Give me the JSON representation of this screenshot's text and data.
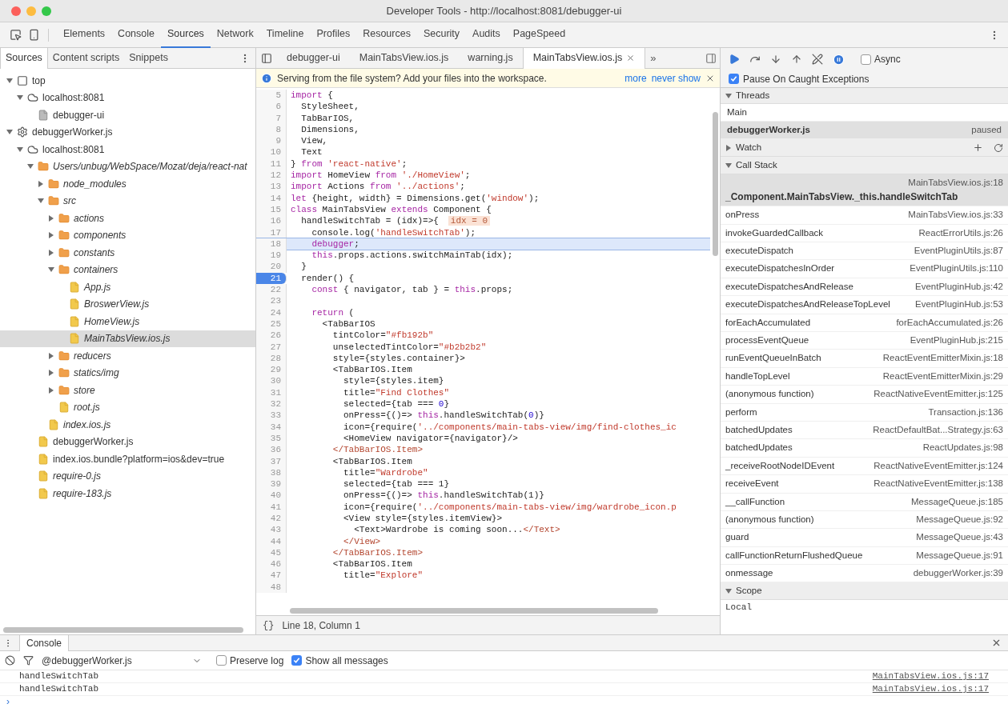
{
  "window": {
    "title": "Developer Tools - http://localhost:8081/debugger-ui"
  },
  "panel_tabs": [
    {
      "label": "Elements",
      "selected": false
    },
    {
      "label": "Console",
      "selected": false
    },
    {
      "label": "Sources",
      "selected": true
    },
    {
      "label": "Network",
      "selected": false
    },
    {
      "label": "Timeline",
      "selected": false
    },
    {
      "label": "Profiles",
      "selected": false
    },
    {
      "label": "Resources",
      "selected": false
    },
    {
      "label": "Security",
      "selected": false
    },
    {
      "label": "Audits",
      "selected": false
    },
    {
      "label": "PageSpeed",
      "selected": false
    }
  ],
  "navigator": {
    "tabs": [
      {
        "label": "Sources",
        "selected": true
      },
      {
        "label": "Content scripts",
        "selected": false
      },
      {
        "label": "Snippets",
        "selected": false
      }
    ],
    "tree": [
      {
        "label": "top",
        "kind": "frame",
        "expanded": true,
        "selected": false,
        "italic": false,
        "children": [
          {
            "label": "localhost:8081",
            "kind": "cloud",
            "expanded": true,
            "selected": false,
            "italic": false,
            "children": [
              {
                "label": "debugger-ui",
                "kind": "page",
                "selected": false,
                "italic": false
              }
            ]
          }
        ]
      },
      {
        "label": "debuggerWorker.js",
        "kind": "gear",
        "expanded": true,
        "selected": false,
        "italic": false,
        "children": [
          {
            "label": "localhost:8081",
            "kind": "cloud",
            "expanded": true,
            "selected": false,
            "italic": false,
            "children": [
              {
                "label": "Users/unbug/WebSpace/Mozat/deja/react-nat",
                "kind": "folder",
                "expanded": true,
                "selected": false,
                "italic": true,
                "children": [
                  {
                    "label": "node_modules",
                    "kind": "folder",
                    "expanded": false,
                    "selected": false,
                    "italic": true
                  },
                  {
                    "label": "src",
                    "kind": "folder",
                    "expanded": true,
                    "selected": false,
                    "italic": true,
                    "children": [
                      {
                        "label": "actions",
                        "kind": "folder",
                        "expanded": false,
                        "selected": false,
                        "italic": true
                      },
                      {
                        "label": "components",
                        "kind": "folder",
                        "expanded": false,
                        "selected": false,
                        "italic": true
                      },
                      {
                        "label": "constants",
                        "kind": "folder",
                        "expanded": false,
                        "selected": false,
                        "italic": true
                      },
                      {
                        "label": "containers",
                        "kind": "folder",
                        "expanded": true,
                        "selected": false,
                        "italic": true,
                        "children": [
                          {
                            "label": "App.js",
                            "kind": "file",
                            "selected": false,
                            "italic": true
                          },
                          {
                            "label": "BroswerView.js",
                            "kind": "file",
                            "selected": false,
                            "italic": true
                          },
                          {
                            "label": "HomeView.js",
                            "kind": "file",
                            "selected": false,
                            "italic": true
                          },
                          {
                            "label": "MainTabsView.ios.js",
                            "kind": "file",
                            "selected": true,
                            "italic": true
                          }
                        ]
                      },
                      {
                        "label": "reducers",
                        "kind": "folder",
                        "expanded": false,
                        "selected": false,
                        "italic": true
                      },
                      {
                        "label": "statics/img",
                        "kind": "folder",
                        "expanded": false,
                        "selected": false,
                        "italic": true
                      },
                      {
                        "label": "store",
                        "kind": "folder",
                        "expanded": false,
                        "selected": false,
                        "italic": true
                      },
                      {
                        "label": "root.js",
                        "kind": "file",
                        "selected": false,
                        "italic": true
                      }
                    ]
                  },
                  {
                    "label": "index.ios.js",
                    "kind": "file",
                    "selected": false,
                    "italic": true
                  }
                ]
              },
              {
                "label": "debuggerWorker.js",
                "kind": "file",
                "selected": false,
                "italic": false
              },
              {
                "label": "index.ios.bundle?platform=ios&dev=true",
                "kind": "file",
                "selected": false,
                "italic": false
              },
              {
                "label": "require-0.js",
                "kind": "file",
                "selected": false,
                "italic": true
              },
              {
                "label": "require-183.js",
                "kind": "file",
                "selected": false,
                "italic": true
              }
            ]
          }
        ]
      }
    ]
  },
  "editor": {
    "tabs": [
      {
        "label": "debugger-ui",
        "selected": false,
        "closable": false
      },
      {
        "label": "MainTabsView.ios.js",
        "selected": false,
        "closable": false
      },
      {
        "label": "warning.js",
        "selected": false,
        "closable": false
      },
      {
        "label": "MainTabsView.ios.js",
        "selected": true,
        "closable": true
      }
    ],
    "more_tabs": "»",
    "infobar": {
      "message": "Serving from the file system? Add your files into the workspace.",
      "links": [
        "more",
        "never show"
      ]
    },
    "lines": [
      {
        "num": "5",
        "current": false,
        "breakpoint": false,
        "segs": [
          {
            "text": "import",
            "kind": "keyword"
          },
          {
            "text": " {",
            "kind": "plain"
          }
        ]
      },
      {
        "num": "6",
        "current": false,
        "breakpoint": false,
        "segs": [
          {
            "text": "  StyleSheet,",
            "kind": "plain"
          }
        ]
      },
      {
        "num": "7",
        "current": false,
        "breakpoint": false,
        "segs": [
          {
            "text": "  TabBarIOS,",
            "kind": "plain"
          }
        ]
      },
      {
        "num": "8",
        "current": false,
        "breakpoint": false,
        "segs": [
          {
            "text": "  Dimensions,",
            "kind": "plain"
          }
        ]
      },
      {
        "num": "9",
        "current": false,
        "breakpoint": false,
        "segs": [
          {
            "text": "  View,",
            "kind": "plain"
          }
        ]
      },
      {
        "num": "10",
        "current": false,
        "breakpoint": false,
        "segs": [
          {
            "text": "  Text",
            "kind": "plain"
          }
        ]
      },
      {
        "num": "11",
        "current": false,
        "breakpoint": false,
        "segs": [
          {
            "text": "} ",
            "kind": "plain"
          },
          {
            "text": "from",
            "kind": "keyword"
          },
          {
            "text": " 'react-native'",
            "kind": "string"
          },
          {
            "text": ";",
            "kind": "plain"
          }
        ]
      },
      {
        "num": "12",
        "current": false,
        "breakpoint": false,
        "segs": [
          {
            "text": "import",
            "kind": "keyword"
          },
          {
            "text": " HomeView ",
            "kind": "plain"
          },
          {
            "text": "from",
            "kind": "keyword"
          },
          {
            "text": " './HomeView'",
            "kind": "string"
          },
          {
            "text": ";",
            "kind": "plain"
          }
        ]
      },
      {
        "num": "13",
        "current": false,
        "breakpoint": false,
        "segs": [
          {
            "text": "import",
            "kind": "keyword"
          },
          {
            "text": " Actions ",
            "kind": "plain"
          },
          {
            "text": "from",
            "kind": "keyword"
          },
          {
            "text": " '../actions'",
            "kind": "string"
          },
          {
            "text": ";",
            "kind": "plain"
          }
        ]
      },
      {
        "num": "14",
        "current": false,
        "breakpoint": false,
        "segs": [
          {
            "text": "let",
            "kind": "keyword"
          },
          {
            "text": " {height, width} = Dimensions.get(",
            "kind": "plain"
          },
          {
            "text": "'window'",
            "kind": "string"
          },
          {
            "text": ");",
            "kind": "plain"
          }
        ]
      },
      {
        "num": "15",
        "current": false,
        "breakpoint": false,
        "segs": [
          {
            "text": "class",
            "kind": "keyword"
          },
          {
            "text": " MainTabsView ",
            "kind": "plain"
          },
          {
            "text": "extends",
            "kind": "keyword"
          },
          {
            "text": " Component {",
            "kind": "plain"
          }
        ]
      },
      {
        "num": "16",
        "current": false,
        "breakpoint": false,
        "segs": [
          {
            "text": "  handleSwitchTab = (idx)=>{",
            "kind": "plain"
          },
          {
            "text": "idx = 0",
            "kind": "inline"
          }
        ]
      },
      {
        "num": "17",
        "current": false,
        "breakpoint": false,
        "segs": [
          {
            "text": "    console.log(",
            "kind": "plain"
          },
          {
            "text": "'handleSwitchTab'",
            "kind": "string"
          },
          {
            "text": ");",
            "kind": "plain"
          }
        ]
      },
      {
        "num": "18",
        "current": true,
        "breakpoint": false,
        "segs": [
          {
            "text": "    debugger",
            "kind": "keyword"
          },
          {
            "text": ";",
            "kind": "plain"
          }
        ]
      },
      {
        "num": "19",
        "current": false,
        "breakpoint": false,
        "segs": [
          {
            "text": "    this",
            "kind": "keyword"
          },
          {
            "text": ".props.actions.switchMainTab(idx);",
            "kind": "plain"
          }
        ]
      },
      {
        "num": "20",
        "current": false,
        "breakpoint": false,
        "segs": [
          {
            "text": "  }",
            "kind": "plain"
          }
        ]
      },
      {
        "num": "21",
        "current": false,
        "breakpoint": true,
        "segs": [
          {
            "text": "  render() {",
            "kind": "plain"
          }
        ]
      },
      {
        "num": "22",
        "current": false,
        "breakpoint": false,
        "segs": [
          {
            "text": "    const",
            "kind": "keyword"
          },
          {
            "text": " { navigator, tab } = ",
            "kind": "plain"
          },
          {
            "text": "this",
            "kind": "keyword"
          },
          {
            "text": ".props;",
            "kind": "plain"
          }
        ]
      },
      {
        "num": "23",
        "current": false,
        "breakpoint": false
      },
      {
        "num": "24",
        "current": false,
        "breakpoint": false,
        "segs": [
          {
            "text": "    return",
            "kind": "keyword"
          },
          {
            "text": " (",
            "kind": "plain"
          }
        ]
      },
      {
        "num": "25",
        "current": false,
        "breakpoint": false,
        "segs": [
          {
            "text": "      <TabBarIOS",
            "kind": "plain"
          }
        ]
      },
      {
        "num": "26",
        "current": false,
        "breakpoint": false,
        "segs": [
          {
            "text": "        tintColor=",
            "kind": "plain"
          },
          {
            "text": "\"#fb192b\"",
            "kind": "string"
          }
        ]
      },
      {
        "num": "27",
        "current": false,
        "breakpoint": false,
        "segs": [
          {
            "text": "        unselectedTintColor=",
            "kind": "plain"
          },
          {
            "text": "\"#b2b2b2\"",
            "kind": "string"
          }
        ]
      },
      {
        "num": "28",
        "current": false,
        "breakpoint": false,
        "segs": [
          {
            "text": "        style={styles.container}>",
            "kind": "plain"
          }
        ]
      },
      {
        "num": "29",
        "current": false,
        "breakpoint": false,
        "segs": [
          {
            "text": "        <TabBarIOS.Item",
            "kind": "plain"
          }
        ]
      },
      {
        "num": "30",
        "current": false,
        "breakpoint": false,
        "segs": [
          {
            "text": "          style={styles.item}",
            "kind": "plain"
          }
        ]
      },
      {
        "num": "31",
        "current": false,
        "breakpoint": false,
        "segs": [
          {
            "text": "          title=",
            "kind": "plain"
          },
          {
            "text": "\"Find Clothes\"",
            "kind": "string"
          }
        ]
      },
      {
        "num": "32",
        "current": false,
        "breakpoint": false,
        "segs": [
          {
            "text": "          selected={tab === ",
            "kind": "plain"
          },
          {
            "text": "0",
            "kind": "number"
          },
          {
            "text": "}",
            "kind": "plain"
          }
        ]
      },
      {
        "num": "33",
        "current": false,
        "breakpoint": false,
        "segs": [
          {
            "text": "          onPress={()=> ",
            "kind": "plain"
          },
          {
            "text": "this",
            "kind": "keyword"
          },
          {
            "text": ".handleSwitchTab(",
            "kind": "plain"
          },
          {
            "text": "0",
            "kind": "number"
          },
          {
            "text": ")}",
            "kind": "plain"
          }
        ]
      },
      {
        "num": "34",
        "current": false,
        "breakpoint": false,
        "segs": [
          {
            "text": "          icon={require(",
            "kind": "plain"
          },
          {
            "text": "'../components/main-tabs-view/img/find-clothes_ic",
            "kind": "string"
          }
        ]
      },
      {
        "num": "35",
        "current": false,
        "breakpoint": false,
        "segs": [
          {
            "text": "          <HomeView navigator={navigator}/>",
            "kind": "plain"
          }
        ]
      },
      {
        "num": "36",
        "current": false,
        "breakpoint": false,
        "segs": [
          {
            "text": "        </TabBarIOS.Item>",
            "kind": "tag"
          }
        ]
      },
      {
        "num": "37",
        "current": false,
        "breakpoint": false,
        "segs": [
          {
            "text": "        <TabBarIOS.Item",
            "kind": "plain"
          }
        ]
      },
      {
        "num": "38",
        "current": false,
        "breakpoint": false,
        "segs": [
          {
            "text": "          title=",
            "kind": "plain"
          },
          {
            "text": "\"Wardrobe\"",
            "kind": "string"
          }
        ]
      },
      {
        "num": "39",
        "current": false,
        "breakpoint": false,
        "segs": [
          {
            "text": "          selected={tab === 1}",
            "kind": "plain"
          }
        ]
      },
      {
        "num": "40",
        "current": false,
        "breakpoint": false,
        "segs": [
          {
            "text": "          onPress={()=> ",
            "kind": "plain"
          },
          {
            "text": "this",
            "kind": "keyword"
          },
          {
            "text": ".handleSwitchTab(1)}",
            "kind": "plain"
          }
        ]
      },
      {
        "num": "41",
        "current": false,
        "breakpoint": false,
        "segs": [
          {
            "text": "          icon={require(",
            "kind": "plain"
          },
          {
            "text": "'../components/main-tabs-view/img/wardrobe_icon.p",
            "kind": "string"
          }
        ]
      },
      {
        "num": "42",
        "current": false,
        "breakpoint": false,
        "segs": [
          {
            "text": "          <View style={styles.itemView}>",
            "kind": "plain"
          }
        ]
      },
      {
        "num": "43",
        "current": false,
        "breakpoint": false,
        "segs": [
          {
            "text": "            <Text>Wardrobe is coming soon...",
            "kind": "plain"
          },
          {
            "text": "</Text>",
            "kind": "tag"
          }
        ]
      },
      {
        "num": "44",
        "current": false,
        "breakpoint": false,
        "segs": [
          {
            "text": "          </View>",
            "kind": "tag"
          }
        ]
      },
      {
        "num": "45",
        "current": false,
        "breakpoint": false,
        "segs": [
          {
            "text": "        </TabBarIOS.Item>",
            "kind": "tag"
          }
        ]
      },
      {
        "num": "46",
        "current": false,
        "breakpoint": false,
        "segs": [
          {
            "text": "        <TabBarIOS.Item",
            "kind": "plain"
          }
        ]
      },
      {
        "num": "47",
        "current": false,
        "breakpoint": false,
        "segs": [
          {
            "text": "          title=",
            "kind": "plain"
          },
          {
            "text": "\"Explore\"",
            "kind": "string"
          }
        ]
      },
      {
        "num": "48",
        "current": false,
        "breakpoint": false
      }
    ],
    "status": {
      "pretty_print": "{}",
      "position": "Line 18, Column 1"
    }
  },
  "debugger": {
    "async": {
      "label": "Async",
      "checked": false
    },
    "pause_on_caught": {
      "label": "Pause On Caught Exceptions",
      "checked": true
    },
    "threads": {
      "title": "Threads",
      "expanded": true,
      "items": [
        {
          "name": "Main",
          "selected": false
        },
        {
          "name": "debuggerWorker.js",
          "status": "paused",
          "selected": true
        }
      ]
    },
    "watch": {
      "title": "Watch",
      "expanded": false
    },
    "call_stack": {
      "title": "Call Stack",
      "expanded": true,
      "frames": [
        {
          "function": "_Component.MainTabsView._this.handleSwitchTab",
          "location": "MainTabsView.ios.js:18",
          "selected": true
        },
        {
          "function": "onPress",
          "location": "MainTabsView.ios.js:33",
          "selected": false
        },
        {
          "function": "invokeGuardedCallback",
          "location": "ReactErrorUtils.js:26",
          "selected": false
        },
        {
          "function": "executeDispatch",
          "location": "EventPluginUtils.js:87",
          "selected": false
        },
        {
          "function": "executeDispatchesInOrder",
          "location": "EventPluginUtils.js:110",
          "selected": false
        },
        {
          "function": "executeDispatchesAndRelease",
          "location": "EventPluginHub.js:42",
          "selected": false
        },
        {
          "function": "executeDispatchesAndReleaseTopLevel",
          "location": "EventPluginHub.js:53",
          "selected": false
        },
        {
          "function": "forEachAccumulated",
          "location": "forEachAccumulated.js:26",
          "selected": false
        },
        {
          "function": "processEventQueue",
          "location": "EventPluginHub.js:215",
          "selected": false
        },
        {
          "function": "runEventQueueInBatch",
          "location": "ReactEventEmitterMixin.js:18",
          "selected": false
        },
        {
          "function": "handleTopLevel",
          "location": "ReactEventEmitterMixin.js:29",
          "selected": false
        },
        {
          "function": "(anonymous function)",
          "location": "ReactNativeEventEmitter.js:125",
          "selected": false
        },
        {
          "function": "perform",
          "location": "Transaction.js:136",
          "selected": false
        },
        {
          "function": "batchedUpdates",
          "location": "ReactDefaultBat...Strategy.js:63",
          "selected": false
        },
        {
          "function": "batchedUpdates",
          "location": "ReactUpdates.js:98",
          "selected": false
        },
        {
          "function": "_receiveRootNodeIDEvent",
          "location": "ReactNativeEventEmitter.js:124",
          "selected": false
        },
        {
          "function": "receiveEvent",
          "location": "ReactNativeEventEmitter.js:138",
          "selected": false
        },
        {
          "function": "__callFunction",
          "location": "MessageQueue.js:185",
          "selected": false
        },
        {
          "function": "(anonymous function)",
          "location": "MessageQueue.js:92",
          "selected": false
        },
        {
          "function": "guard",
          "location": "MessageQueue.js:43",
          "selected": false
        },
        {
          "function": "callFunctionReturnFlushedQueue",
          "location": "MessageQueue.js:91",
          "selected": false
        },
        {
          "function": "onmessage",
          "location": "debuggerWorker.js:39",
          "selected": false
        }
      ]
    },
    "scope": {
      "title": "Scope",
      "expanded": true,
      "items": [
        "Local"
      ]
    }
  },
  "console": {
    "tab": "Console",
    "context": "@debuggerWorker.js",
    "preserve_log": {
      "label": "Preserve log",
      "checked": false
    },
    "show_all": {
      "label": "Show all messages",
      "checked": true
    },
    "messages": [
      {
        "text": "handleSwitchTab",
        "source": "MainTabsView.ios.js:17"
      },
      {
        "text": "handleSwitchTab",
        "source": "MainTabsView.ios.js:17"
      }
    ],
    "prompt": "›"
  }
}
